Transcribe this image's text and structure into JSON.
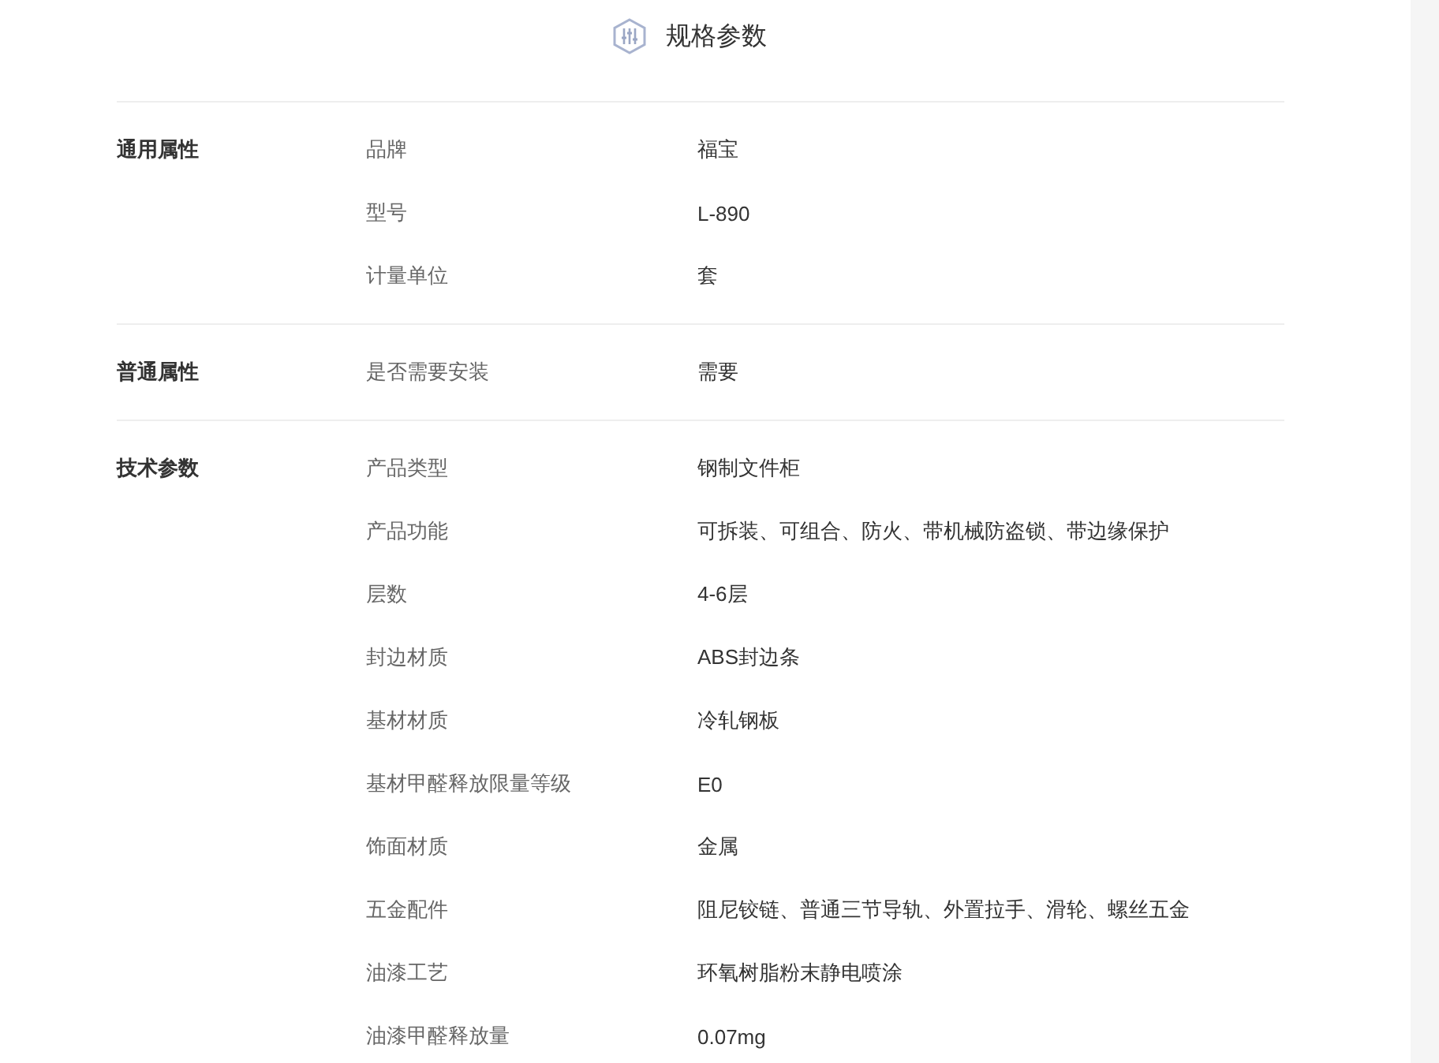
{
  "title": "规格参数",
  "groups": [
    {
      "label": "通用属性",
      "rows": [
        {
          "name": "品牌",
          "value": "福宝"
        },
        {
          "name": "型号",
          "value": "L-890"
        },
        {
          "name": "计量单位",
          "value": "套"
        }
      ]
    },
    {
      "label": "普通属性",
      "rows": [
        {
          "name": "是否需要安装",
          "value": "需要"
        }
      ]
    },
    {
      "label": "技术参数",
      "rows": [
        {
          "name": "产品类型",
          "value": "钢制文件柜"
        },
        {
          "name": "产品功能",
          "value": "可拆装、可组合、防火、带机械防盗锁、带边缘保护"
        },
        {
          "name": "层数",
          "value": "4-6层"
        },
        {
          "name": "封边材质",
          "value": "ABS封边条"
        },
        {
          "name": "基材材质",
          "value": "冷轧钢板"
        },
        {
          "name": "基材甲醛释放限量等级",
          "value": "E0"
        },
        {
          "name": "饰面材质",
          "value": "金属"
        },
        {
          "name": "五金配件",
          "value": "阻尼铰链、普通三节导轨、外置拉手、滑轮、螺丝五金"
        },
        {
          "name": "油漆工艺",
          "value": "环氧树脂粉末静电喷涂"
        },
        {
          "name": "油漆甲醛释放量",
          "value": "0.07mg"
        }
      ]
    }
  ]
}
